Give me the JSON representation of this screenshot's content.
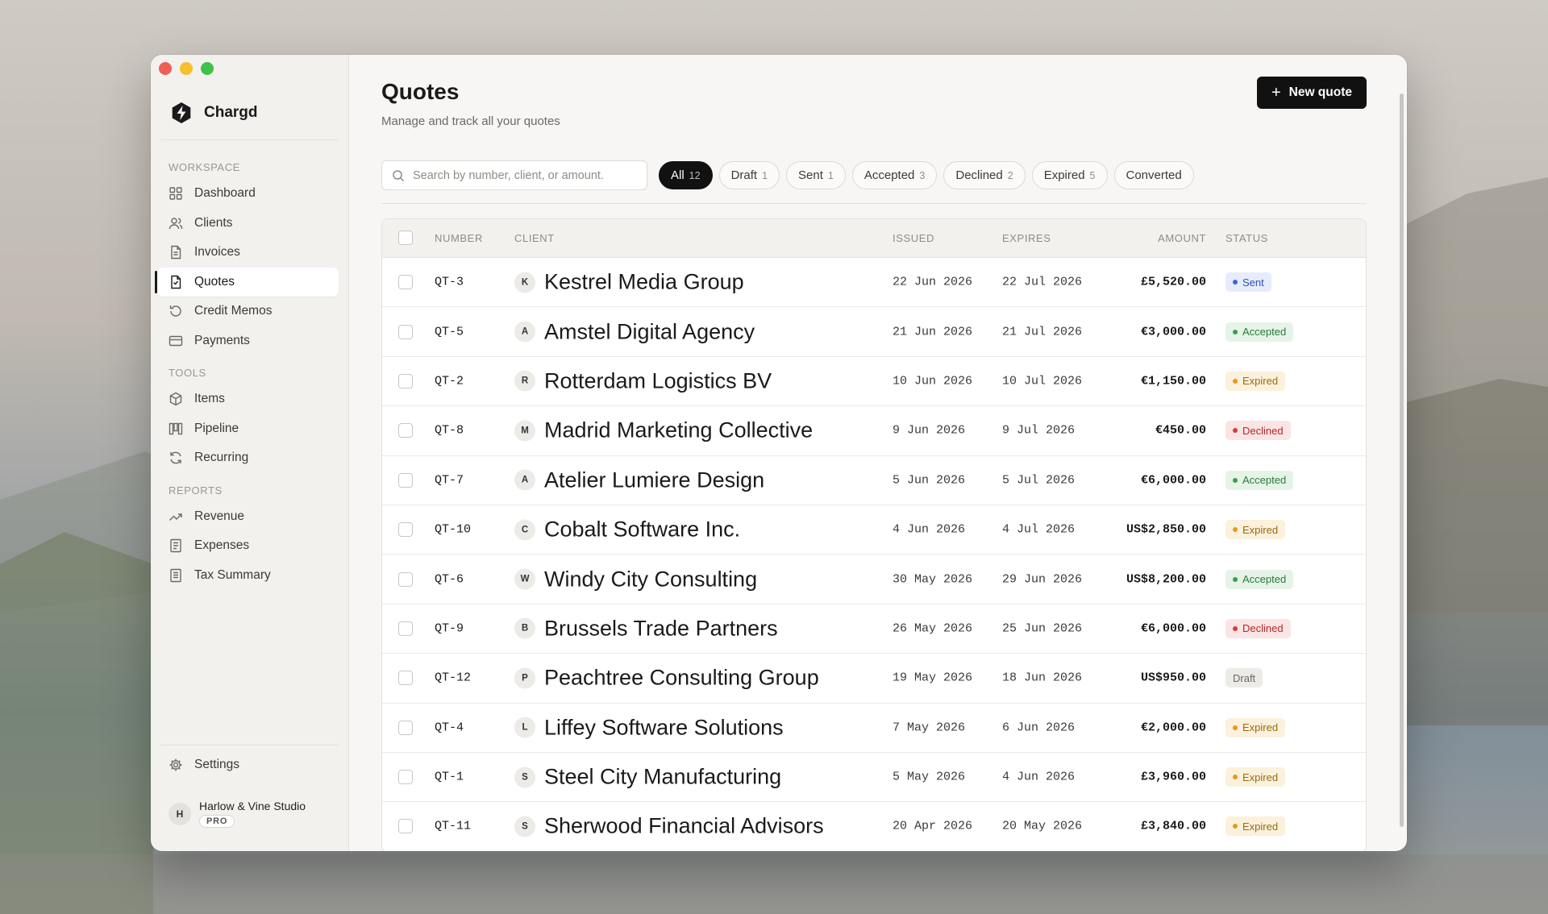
{
  "app": {
    "name": "Chargd"
  },
  "sidebar": {
    "sections": [
      {
        "label": "WORKSPACE",
        "items": [
          {
            "label": "Dashboard",
            "icon": "grid-icon"
          },
          {
            "label": "Clients",
            "icon": "users-icon"
          },
          {
            "label": "Invoices",
            "icon": "file-icon"
          },
          {
            "label": "Quotes",
            "icon": "quote-file-icon",
            "active": true
          },
          {
            "label": "Credit Memos",
            "icon": "undo-icon"
          },
          {
            "label": "Payments",
            "icon": "card-icon"
          }
        ]
      },
      {
        "label": "TOOLS",
        "items": [
          {
            "label": "Items",
            "icon": "box-icon"
          },
          {
            "label": "Pipeline",
            "icon": "columns-icon"
          },
          {
            "label": "Recurring",
            "icon": "refresh-icon"
          }
        ]
      },
      {
        "label": "REPORTS",
        "items": [
          {
            "label": "Revenue",
            "icon": "trend-icon"
          },
          {
            "label": "Expenses",
            "icon": "receipt-icon"
          },
          {
            "label": "Tax Summary",
            "icon": "document-icon"
          }
        ]
      }
    ],
    "settings_label": "Settings",
    "user": {
      "initial": "H",
      "name": "Harlow & Vine Studio",
      "plan": "PRO"
    }
  },
  "header": {
    "title": "Quotes",
    "subtitle": "Manage and track all your quotes",
    "new_button": "New quote"
  },
  "search": {
    "placeholder": "Search by number, client, or amount."
  },
  "filters": [
    {
      "label": "All",
      "count": "12",
      "active": true
    },
    {
      "label": "Draft",
      "count": "1"
    },
    {
      "label": "Sent",
      "count": "1"
    },
    {
      "label": "Accepted",
      "count": "3"
    },
    {
      "label": "Declined",
      "count": "2"
    },
    {
      "label": "Expired",
      "count": "5"
    },
    {
      "label": "Converted",
      "count": ""
    }
  ],
  "table": {
    "columns": {
      "number": "NUMBER",
      "client": "CLIENT",
      "issued": "ISSUED",
      "expires": "EXPIRES",
      "amount": "AMOUNT",
      "status": "STATUS"
    },
    "rows": [
      {
        "number": "QT-3",
        "initial": "K",
        "client": "Kestrel Media Group",
        "issued": "22 Jun 2026",
        "expires": "22 Jul 2026",
        "amount": "£5,520.00",
        "status": "Sent"
      },
      {
        "number": "QT-5",
        "initial": "A",
        "client": "Amstel Digital Agency",
        "issued": "21 Jun 2026",
        "expires": "21 Jul 2026",
        "amount": "€3,000.00",
        "status": "Accepted"
      },
      {
        "number": "QT-2",
        "initial": "R",
        "client": "Rotterdam Logistics BV",
        "issued": "10 Jun 2026",
        "expires": "10 Jul 2026",
        "amount": "€1,150.00",
        "status": "Expired"
      },
      {
        "number": "QT-8",
        "initial": "M",
        "client": "Madrid Marketing Collective",
        "issued": "9 Jun 2026",
        "expires": "9 Jul 2026",
        "amount": "€450.00",
        "status": "Declined"
      },
      {
        "number": "QT-7",
        "initial": "A",
        "client": "Atelier Lumiere Design",
        "issued": "5 Jun 2026",
        "expires": "5 Jul 2026",
        "amount": "€6,000.00",
        "status": "Accepted"
      },
      {
        "number": "QT-10",
        "initial": "C",
        "client": "Cobalt Software Inc.",
        "issued": "4 Jun 2026",
        "expires": "4 Jul 2026",
        "amount": "US$2,850.00",
        "status": "Expired"
      },
      {
        "number": "QT-6",
        "initial": "W",
        "client": "Windy City Consulting",
        "issued": "30 May 2026",
        "expires": "29 Jun 2026",
        "amount": "US$8,200.00",
        "status": "Accepted"
      },
      {
        "number": "QT-9",
        "initial": "B",
        "client": "Brussels Trade Partners",
        "issued": "26 May 2026",
        "expires": "25 Jun 2026",
        "amount": "€6,000.00",
        "status": "Declined"
      },
      {
        "number": "QT-12",
        "initial": "P",
        "client": "Peachtree Consulting Group",
        "issued": "19 May 2026",
        "expires": "18 Jun 2026",
        "amount": "US$950.00",
        "status": "Draft"
      },
      {
        "number": "QT-4",
        "initial": "L",
        "client": "Liffey Software Solutions",
        "issued": "7 May 2026",
        "expires": "6 Jun 2026",
        "amount": "€2,000.00",
        "status": "Expired"
      },
      {
        "number": "QT-1",
        "initial": "S",
        "client": "Steel City Manufacturing",
        "issued": "5 May 2026",
        "expires": "4 Jun 2026",
        "amount": "£3,960.00",
        "status": "Expired"
      },
      {
        "number": "QT-11",
        "initial": "S",
        "client": "Sherwood Financial Advisors",
        "issued": "20 Apr 2026",
        "expires": "20 May 2026",
        "amount": "£3,840.00",
        "status": "Expired"
      }
    ]
  }
}
